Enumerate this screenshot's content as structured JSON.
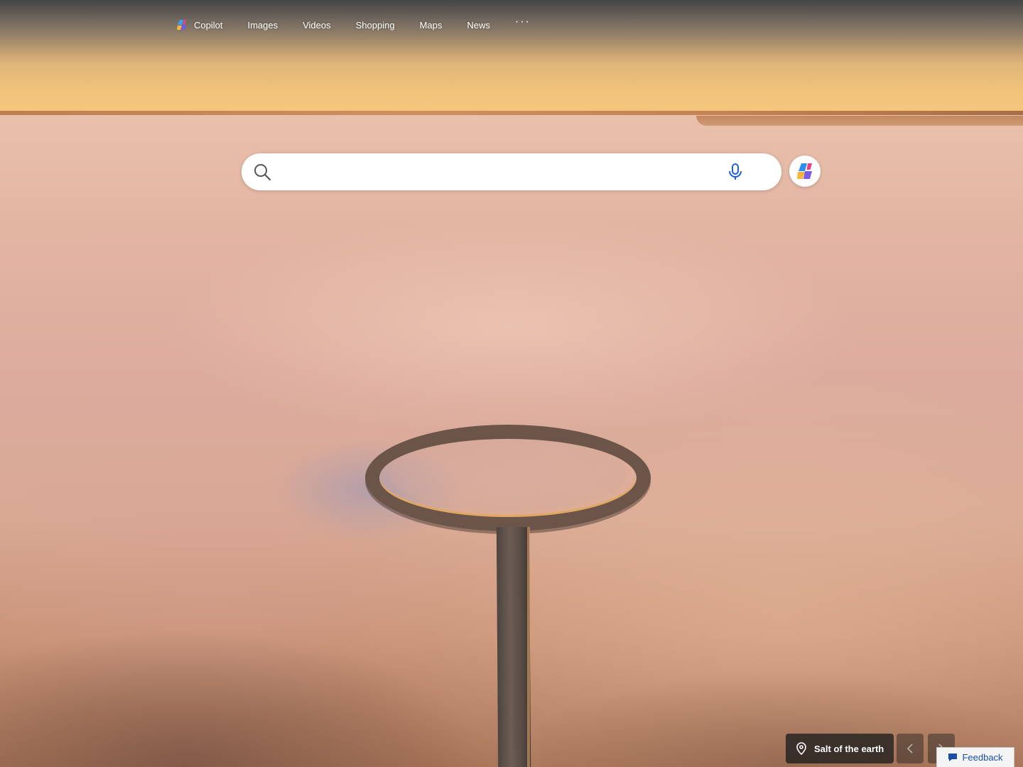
{
  "nav": {
    "items": [
      {
        "label": "Copilot",
        "icon": "copilot-icon"
      },
      {
        "label": "Images"
      },
      {
        "label": "Videos"
      },
      {
        "label": "Shopping"
      },
      {
        "label": "Maps"
      },
      {
        "label": "News"
      }
    ],
    "more_label": "···"
  },
  "search": {
    "value": "",
    "placeholder": "",
    "icon": "search-icon",
    "mic_icon": "microphone-icon",
    "copilot_icon": "copilot-icon"
  },
  "image_info": {
    "title": "Salt of the earth",
    "icon": "location-pin-icon"
  },
  "carousel": {
    "prev_label": "‹",
    "next_label": "›"
  },
  "feedback": {
    "label": "Feedback",
    "icon": "feedback-icon"
  },
  "colors": {
    "accent": "#1a4ea8",
    "mic": "#1f5fd1"
  }
}
